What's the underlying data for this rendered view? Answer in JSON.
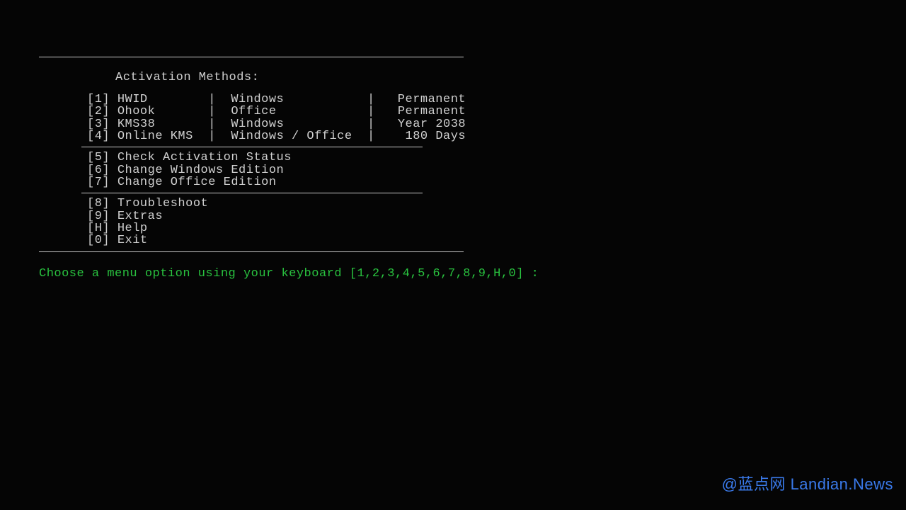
{
  "title": "Activation Methods:",
  "methods": [
    {
      "key": "[1]",
      "name": "HWID",
      "target": "Windows",
      "duration": "Permanent"
    },
    {
      "key": "[2]",
      "name": "Ohook",
      "target": "Office",
      "duration": "Permanent"
    },
    {
      "key": "[3]",
      "name": "KMS38",
      "target": "Windows",
      "duration": "Year 2038"
    },
    {
      "key": "[4]",
      "name": "Online KMS",
      "target": "Windows / Office",
      "duration": "180 Days"
    }
  ],
  "utils": [
    {
      "key": "[5]",
      "label": "Check Activation Status"
    },
    {
      "key": "[6]",
      "label": "Change Windows Edition"
    },
    {
      "key": "[7]",
      "label": "Change Office Edition"
    }
  ],
  "other": [
    {
      "key": "[8]",
      "label": "Troubleshoot"
    },
    {
      "key": "[9]",
      "label": "Extras"
    },
    {
      "key": "[H]",
      "label": "Help"
    },
    {
      "key": "[0]",
      "label": "Exit"
    }
  ],
  "prompt": "Choose a menu option using your keyboard [1,2,3,4,5,6,7,8,9,H,0] :",
  "watermark": "@蓝点网 Landian.News"
}
